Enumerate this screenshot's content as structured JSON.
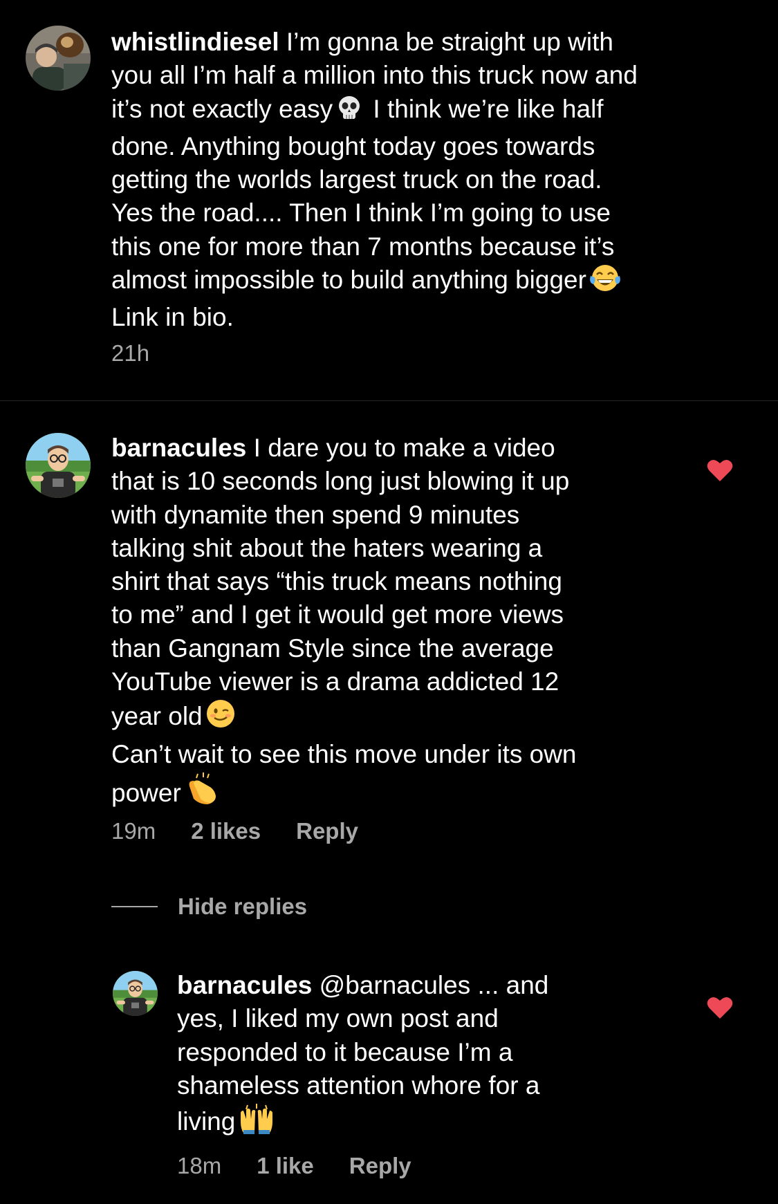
{
  "comments": [
    {
      "username": "whistlindiesel",
      "text_lines_before_emoji1": "I’m gonna be straight up with\nyou all I’m half a million into this truck now and\nit’s not exactly easy",
      "emoji1": "skull-emoji",
      "text_after_emoji1": "I think we’re like half\ndone. Anything bought today goes towards\ngetting the worlds largest truck on the road.\nYes the road.... Then I think I’m going to use\nthis one for more than 7 months because it’s\nalmost impossible to build anything bigger",
      "emoji2": "tears-of-joy-emoji",
      "text_end": "Link in bio.",
      "time": "21h"
    },
    {
      "username": "barnacules",
      "text_part1": "I dare you to make a video\nthat is 10 seconds long just blowing it up\nwith dynamite then spend 9 minutes\ntalking shit about the haters wearing a\nshirt that says “this truck means nothing\nto me” and I get it would get more views\nthan Gangnam Style since the average\nYouTube viewer is a drama addicted 12\nyear old",
      "emoji1": "winking-face-emoji",
      "text_part2": "Can’t wait to see this move under its own\npower",
      "emoji2": "clapping-hands-emoji",
      "time": "19m",
      "likes": "2 likes",
      "reply_label": "Reply",
      "liked": true,
      "heart_color": "#ed4956"
    }
  ],
  "hide_replies_label": "Hide replies",
  "reply": {
    "username": "barnacules",
    "mention": "@barnacules",
    "text": "... and\nyes, I liked my own post and\nresponded to it because I’m a\nshameless attention whore for a\nliving",
    "emoji": "raising-hands-emoji",
    "time": "18m",
    "likes": "1 like",
    "reply_label": "Reply",
    "liked": true,
    "heart_color": "#ed4956"
  },
  "colors": {
    "background": "#000000",
    "text": "#ffffff",
    "secondary": "#a8a8a8",
    "divider": "#262626"
  }
}
